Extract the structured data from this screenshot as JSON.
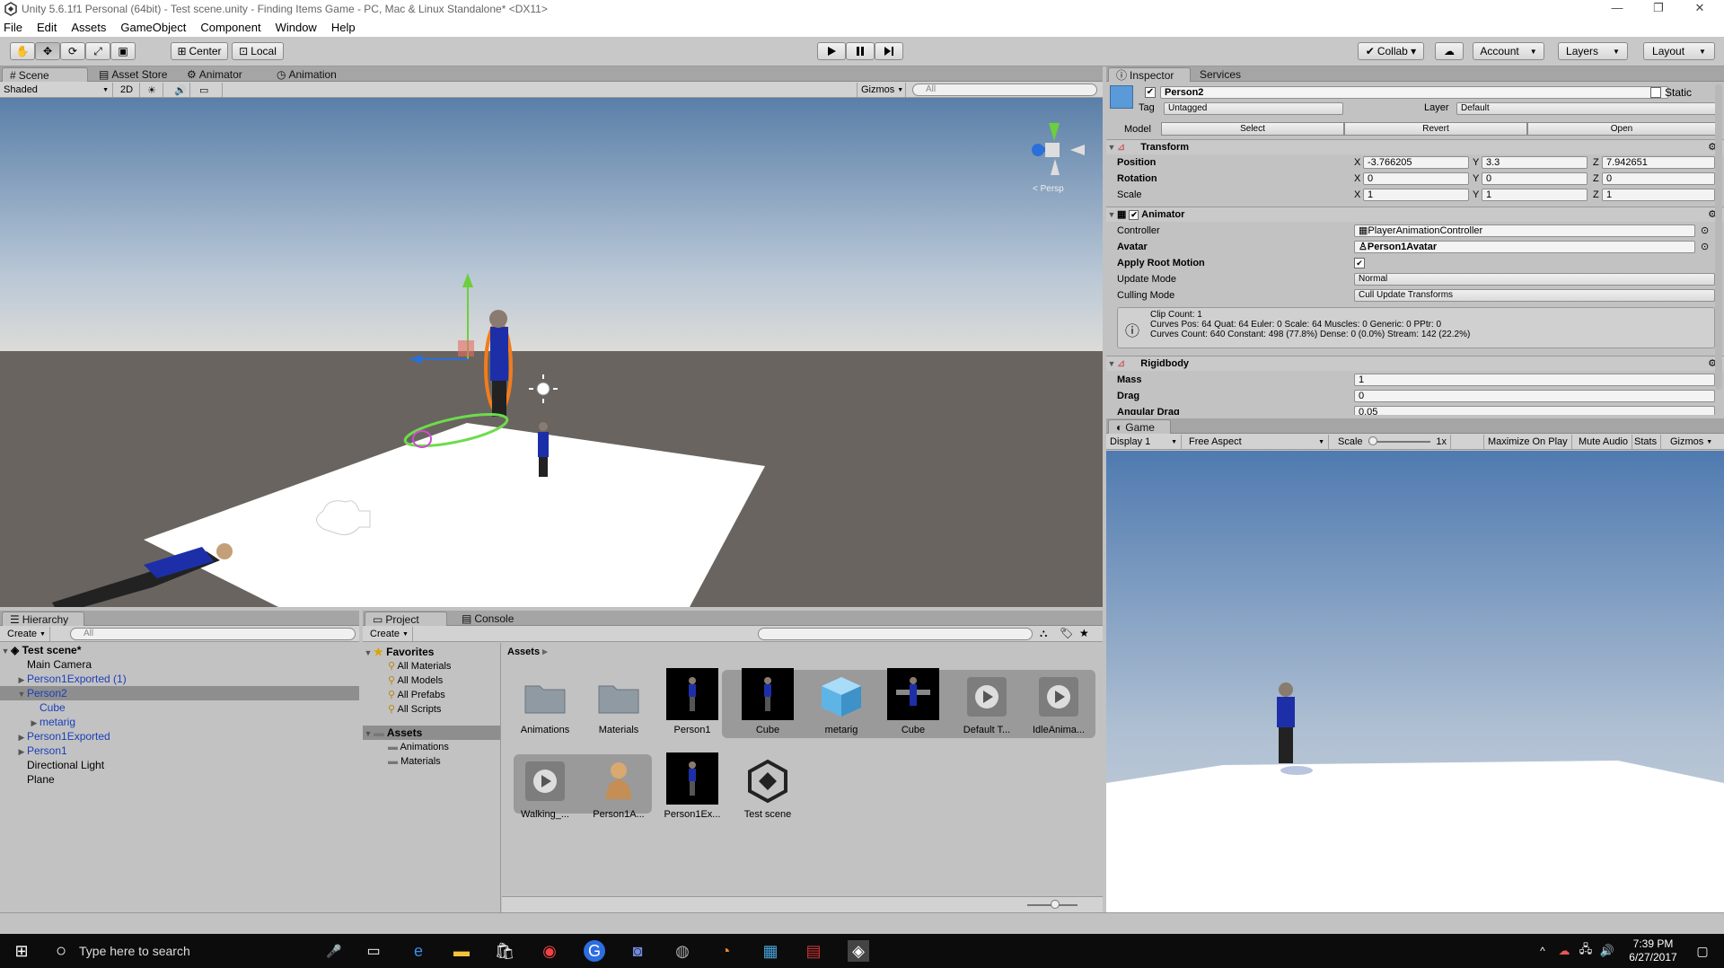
{
  "window": {
    "title": "Unity 5.6.1f1 Personal (64bit) - Test scene.unity - Finding Items Game - PC, Mac & Linux Standalone* <DX11>",
    "minimize": "—",
    "maximize": "❐",
    "close": "✕"
  },
  "menu": [
    "File",
    "Edit",
    "Assets",
    "GameObject",
    "Component",
    "Window",
    "Help"
  ],
  "toolbar": {
    "center_label": "Center",
    "local_label": "Local",
    "collab_label": "Collab ▾",
    "account_label": "Account",
    "layers_label": "Layers",
    "layout_label": "Layout"
  },
  "scene_panel": {
    "tabs": [
      "Scene",
      "Asset Store",
      "Animator",
      "Animation"
    ],
    "shading_mode": "Shaded",
    "mode_2d": "2D",
    "gizmos_label": "Gizmos",
    "search_placeholder": "All",
    "persp_label": "< Persp"
  },
  "inspector": {
    "tabs": [
      "Inspector",
      "Services"
    ],
    "object_name": "Person2",
    "static_label": "Static",
    "tag_label": "Tag",
    "tag_value": "Untagged",
    "layer_label": "Layer",
    "layer_value": "Default",
    "model_label": "Model",
    "model_buttons": [
      "Select",
      "Revert",
      "Open"
    ],
    "transform": {
      "title": "Transform",
      "position_label": "Position",
      "rotation_label": "Rotation",
      "scale_label": "Scale",
      "position": {
        "x": "-3.766205",
        "y": "3.3",
        "z": "7.942651"
      },
      "rotation": {
        "x": "0",
        "y": "0",
        "z": "0"
      },
      "scale": {
        "x": "1",
        "y": "1",
        "z": "1"
      }
    },
    "animator": {
      "title": "Animator",
      "controller_label": "Controller",
      "controller_value": "PlayerAnimationController",
      "avatar_label": "Avatar",
      "avatar_value": "Person1Avatar",
      "root_motion_label": "Apply Root Motion",
      "update_mode_label": "Update Mode",
      "update_mode_value": "Normal",
      "culling_mode_label": "Culling Mode",
      "culling_mode_value": "Cull Update Transforms",
      "info_line1": "Clip Count: 1",
      "info_line2": "Curves Pos: 64 Quat: 64 Euler: 0 Scale: 64 Muscles: 0 Generic: 0 PPtr: 0",
      "info_line3": "Curves Count: 640 Constant: 498 (77.8%) Dense: 0 (0.0%) Stream: 142 (22.2%)"
    },
    "rigidbody": {
      "title": "Rigidbody",
      "mass_label": "Mass",
      "mass_value": "1",
      "drag_label": "Drag",
      "drag_value": "0",
      "angular_label": "Angular Drag",
      "angular_value": "0.05"
    }
  },
  "game_panel": {
    "tab": "Game",
    "display": "Display 1",
    "aspect": "Free Aspect",
    "scale_label": "Scale",
    "scale_value": "1x",
    "buttons": [
      "Maximize On Play",
      "Mute Audio",
      "Stats",
      "Gizmos"
    ]
  },
  "hierarchy": {
    "tab": "Hierarchy",
    "create_label": "Create",
    "search_placeholder": "All",
    "scene_name": "Test scene*",
    "items": [
      {
        "label": "Main Camera"
      },
      {
        "label": "Person1Exported (1)"
      },
      {
        "label": "Person2"
      },
      {
        "label": "Cube"
      },
      {
        "label": "metarig"
      },
      {
        "label": "Person1Exported"
      },
      {
        "label": "Person1"
      },
      {
        "label": "Directional Light"
      },
      {
        "label": "Plane"
      }
    ]
  },
  "project": {
    "tabs": [
      "Project",
      "Console"
    ],
    "create_label": "Create",
    "favorites_label": "Favorites",
    "favorites": [
      "All Materials",
      "All Models",
      "All Prefabs",
      "All Scripts"
    ],
    "assets_label": "Assets",
    "asset_folders": [
      "Animations",
      "Materials"
    ],
    "breadcrumb": "Assets",
    "assets": [
      {
        "label": "Animations",
        "kind": "folder"
      },
      {
        "label": "Materials",
        "kind": "folder"
      },
      {
        "label": "Person1",
        "kind": "model"
      },
      {
        "label": "Cube",
        "kind": "model"
      },
      {
        "label": "metarig",
        "kind": "cube"
      },
      {
        "label": "Cube",
        "kind": "rig"
      },
      {
        "label": "Default T...",
        "kind": "anim"
      },
      {
        "label": "IdleAnima...",
        "kind": "anim"
      },
      {
        "label": "Walking_...",
        "kind": "anim"
      },
      {
        "label": "Person1A...",
        "kind": "avatar"
      },
      {
        "label": "Person1Ex...",
        "kind": "model"
      },
      {
        "label": "Test scene",
        "kind": "unity"
      }
    ]
  },
  "taskbar": {
    "search_placeholder": "Type here to search",
    "time": "7:39 PM",
    "date": "6/27/2017"
  },
  "colors": {
    "accent_blue": "#1b3fb8",
    "selection": "#8e8e8e",
    "panel_bg": "#c2c2c2",
    "sky_top": "#8fb6de",
    "ground": "#6a6560"
  }
}
